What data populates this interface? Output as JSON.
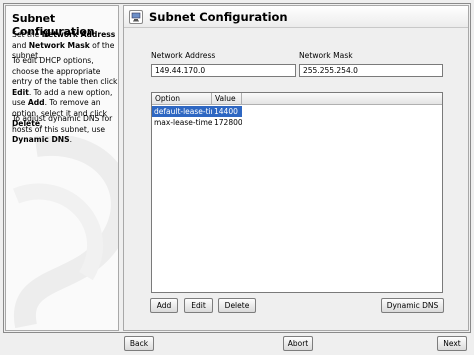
{
  "help": {
    "title": "Subnet Configuration",
    "p1_a": "Set the ",
    "p1_b": "Network Address",
    "p1_c": " and ",
    "p1_d": "Network Mask",
    "p1_e": " of the subnet.",
    "p2_a": "To edit DHCP options, choose the appropriate entry of the table then click ",
    "p2_b": "Edit",
    "p2_c": ". To add a new option, use ",
    "p2_d": "Add",
    "p2_e": ". To remove an option, select it and click ",
    "p2_f": "Delete",
    "p2_g": ".",
    "p3_a": "To adjust dynamic DNS for hosts of this subnet, use ",
    "p3_b": "Dynamic DNS",
    "p3_c": "."
  },
  "main": {
    "title": "Subnet Configuration",
    "network_address_label": "Network Address",
    "network_address_value": "149.44.170.0",
    "network_mask_label": "Network Mask",
    "network_mask_value": "255.255.254.0"
  },
  "table": {
    "columns": [
      "Option",
      "Value"
    ],
    "rows": [
      {
        "option": "default-lease-time",
        "value": "14400"
      },
      {
        "option": "max-lease-time",
        "value": "172800"
      }
    ]
  },
  "buttons": {
    "add": "Add",
    "edit": "Edit",
    "delete": "Delete",
    "dynamic_dns": "Dynamic DNS",
    "back": "Back",
    "abort": "Abort",
    "next": "Next"
  },
  "colors": {
    "selection": "#2e67c2"
  }
}
